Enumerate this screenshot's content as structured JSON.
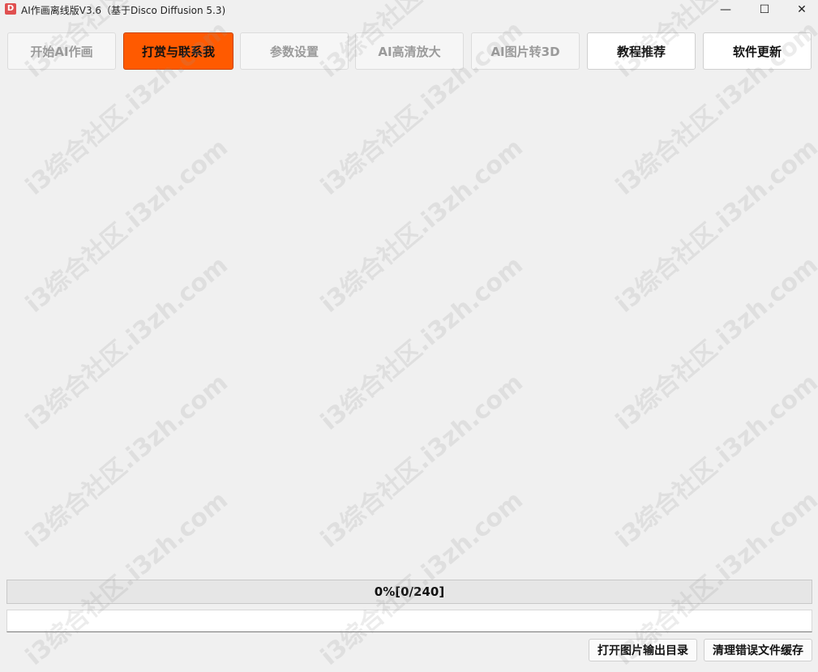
{
  "window": {
    "title": "AI作画离线版V3.6（基于Disco Diffusion 5.3)",
    "icon_label": "D",
    "controls": {
      "minimize": "—",
      "maximize": "☐",
      "close": "✕"
    }
  },
  "tabs": [
    {
      "label": "开始AI作画",
      "state": "inactive"
    },
    {
      "label": "打赏与联系我",
      "state": "active"
    },
    {
      "label": "参数设置",
      "state": "inactive"
    },
    {
      "label": "AI高清放大",
      "state": "inactive"
    },
    {
      "label": "AI图片转3D",
      "state": "inactive"
    },
    {
      "label": "教程推荐",
      "state": "enabled"
    },
    {
      "label": "软件更新",
      "state": "enabled"
    }
  ],
  "progress": {
    "text": "0%[0/240]",
    "value": 0,
    "total": 240
  },
  "status_field": {
    "value": ""
  },
  "buttons": {
    "open_output": "打开图片输出目录",
    "clear_cache": "清理错误文件缓存"
  },
  "watermark": {
    "text": "i3综合社区.i3zh.com"
  },
  "colors": {
    "accent": "#ff5a00",
    "background": "#f0f0f0"
  }
}
